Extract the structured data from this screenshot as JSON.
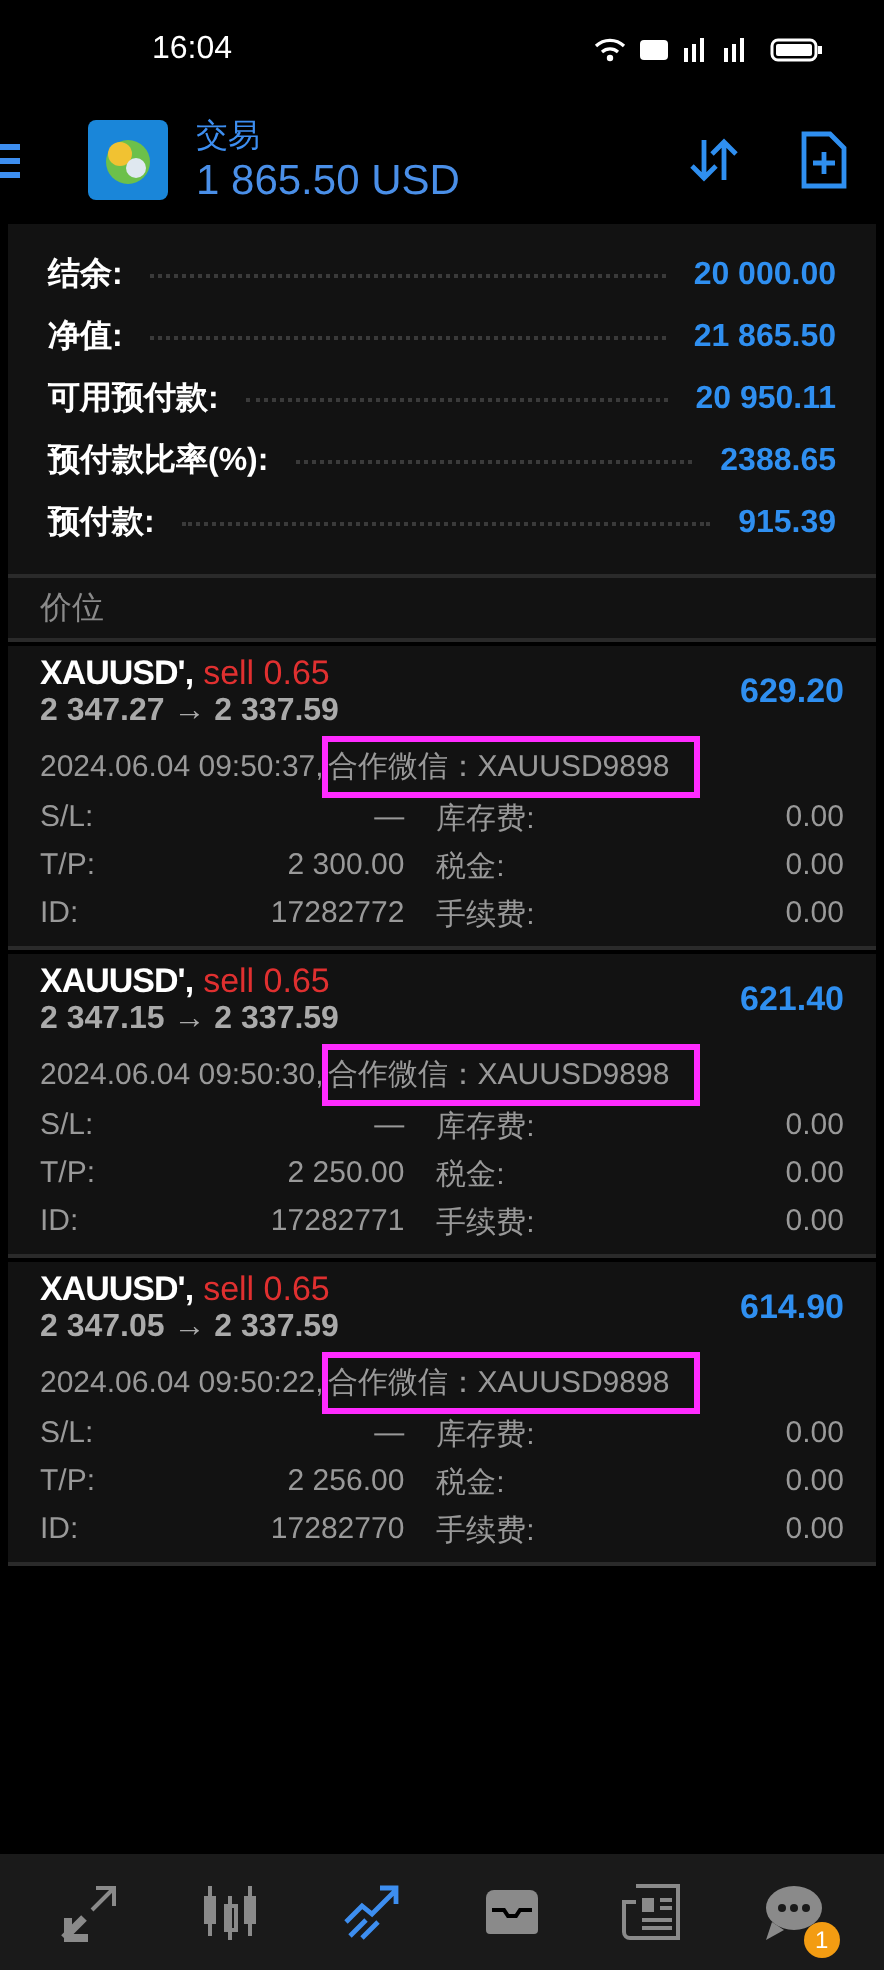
{
  "status_bar": {
    "time": "16:04"
  },
  "header": {
    "title": "交易",
    "balance": "1 865.50 USD"
  },
  "summary": [
    {
      "label": "结余:",
      "value": "20 000.00"
    },
    {
      "label": "净值:",
      "value": "21 865.50"
    },
    {
      "label": "可用预付款:",
      "value": "20 950.11"
    },
    {
      "label": "预付款比率(%):",
      "value": "2388.65"
    },
    {
      "label": "预付款:",
      "value": "915.39"
    }
  ],
  "section_title": "价位",
  "positions": [
    {
      "symbol": "XAUUSD',",
      "side": "sell 0.65",
      "prices": "2 347.27 → 2 337.59",
      "profit": "629.20",
      "time": "2024.06.04 09:50:37,",
      "comment": "合作微信：XAUUSD9898",
      "highlighted": true,
      "fields": [
        {
          "label": "S/L:",
          "value": "—"
        },
        {
          "label": "库存费:",
          "value": "0.00"
        },
        {
          "label": "T/P:",
          "value": "2 300.00"
        },
        {
          "label": "税金:",
          "value": "0.00"
        },
        {
          "label": "ID:",
          "value": "17282772"
        },
        {
          "label": "手续费:",
          "value": "0.00"
        }
      ]
    },
    {
      "symbol": "XAUUSD',",
      "side": "sell 0.65",
      "prices": "2 347.15 → 2 337.59",
      "profit": "621.40",
      "time": "2024.06.04 09:50:30,",
      "comment": "合作微信：XAUUSD9898",
      "highlighted": true,
      "fields": [
        {
          "label": "S/L:",
          "value": "—"
        },
        {
          "label": "库存费:",
          "value": "0.00"
        },
        {
          "label": "T/P:",
          "value": "2 250.00"
        },
        {
          "label": "税金:",
          "value": "0.00"
        },
        {
          "label": "ID:",
          "value": "17282771"
        },
        {
          "label": "手续费:",
          "value": "0.00"
        }
      ]
    },
    {
      "symbol": "XAUUSD',",
      "side": "sell 0.65",
      "prices": "2 347.05 → 2 337.59",
      "profit": "614.90",
      "time": "2024.06.04 09:50:22,",
      "comment": "合作微信：XAUUSD9898",
      "highlighted": true,
      "fields": [
        {
          "label": "S/L:",
          "value": "—"
        },
        {
          "label": "库存费:",
          "value": "0.00"
        },
        {
          "label": "T/P:",
          "value": "2 256.00"
        },
        {
          "label": "税金:",
          "value": "0.00"
        },
        {
          "label": "ID:",
          "value": "17282770"
        },
        {
          "label": "手续费:",
          "value": "0.00"
        }
      ]
    }
  ],
  "nav": [
    {
      "kind": "quotes",
      "selected": false
    },
    {
      "kind": "chart",
      "selected": false
    },
    {
      "kind": "trade",
      "selected": true
    },
    {
      "kind": "history",
      "selected": false
    },
    {
      "kind": "news",
      "selected": false
    },
    {
      "kind": "messages",
      "selected": false,
      "badge": "1"
    }
  ]
}
